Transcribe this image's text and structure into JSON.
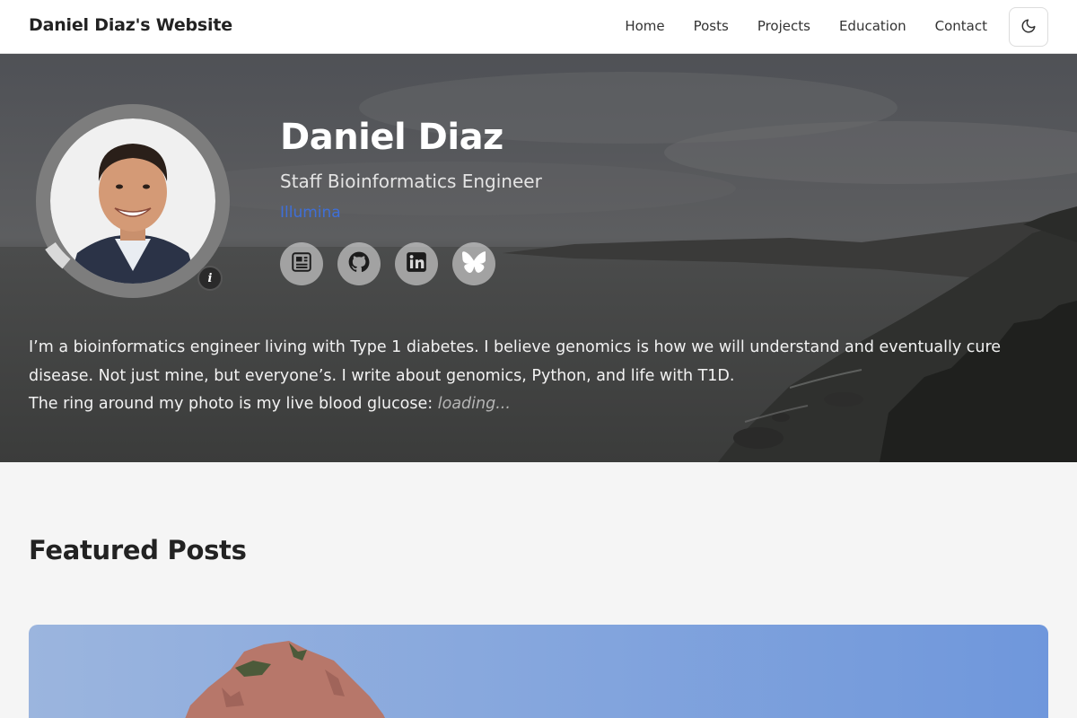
{
  "navbar": {
    "site_title": "Daniel Diaz's Website",
    "links": [
      {
        "label": "Home"
      },
      {
        "label": "Posts"
      },
      {
        "label": "Projects"
      },
      {
        "label": "Education"
      },
      {
        "label": "Contact"
      }
    ],
    "theme_toggle_icon": "moon-icon"
  },
  "hero": {
    "name": "Daniel Diaz",
    "role": "Staff Bioinformatics Engineer",
    "company": "Illumina",
    "info_badge": "i",
    "social_icons": [
      "resume-icon",
      "github-icon",
      "linkedin-icon",
      "bluesky-icon"
    ],
    "bio_line1": "I’m a bioinformatics engineer living with Type 1 diabetes. I believe genomics is how we will understand and eventually cure disease. Not just mine, but everyone’s. I write about genomics, Python, and life with T1D.",
    "bio_line2_prefix": "The ring around my photo is my live blood glucose: ",
    "bio_loading": "loading..."
  },
  "featured": {
    "title": "Featured Posts"
  },
  "colors": {
    "accent_link": "#3f6fd8",
    "navbar_bg": "#ffffff",
    "page_bg": "#f5f5f5"
  }
}
